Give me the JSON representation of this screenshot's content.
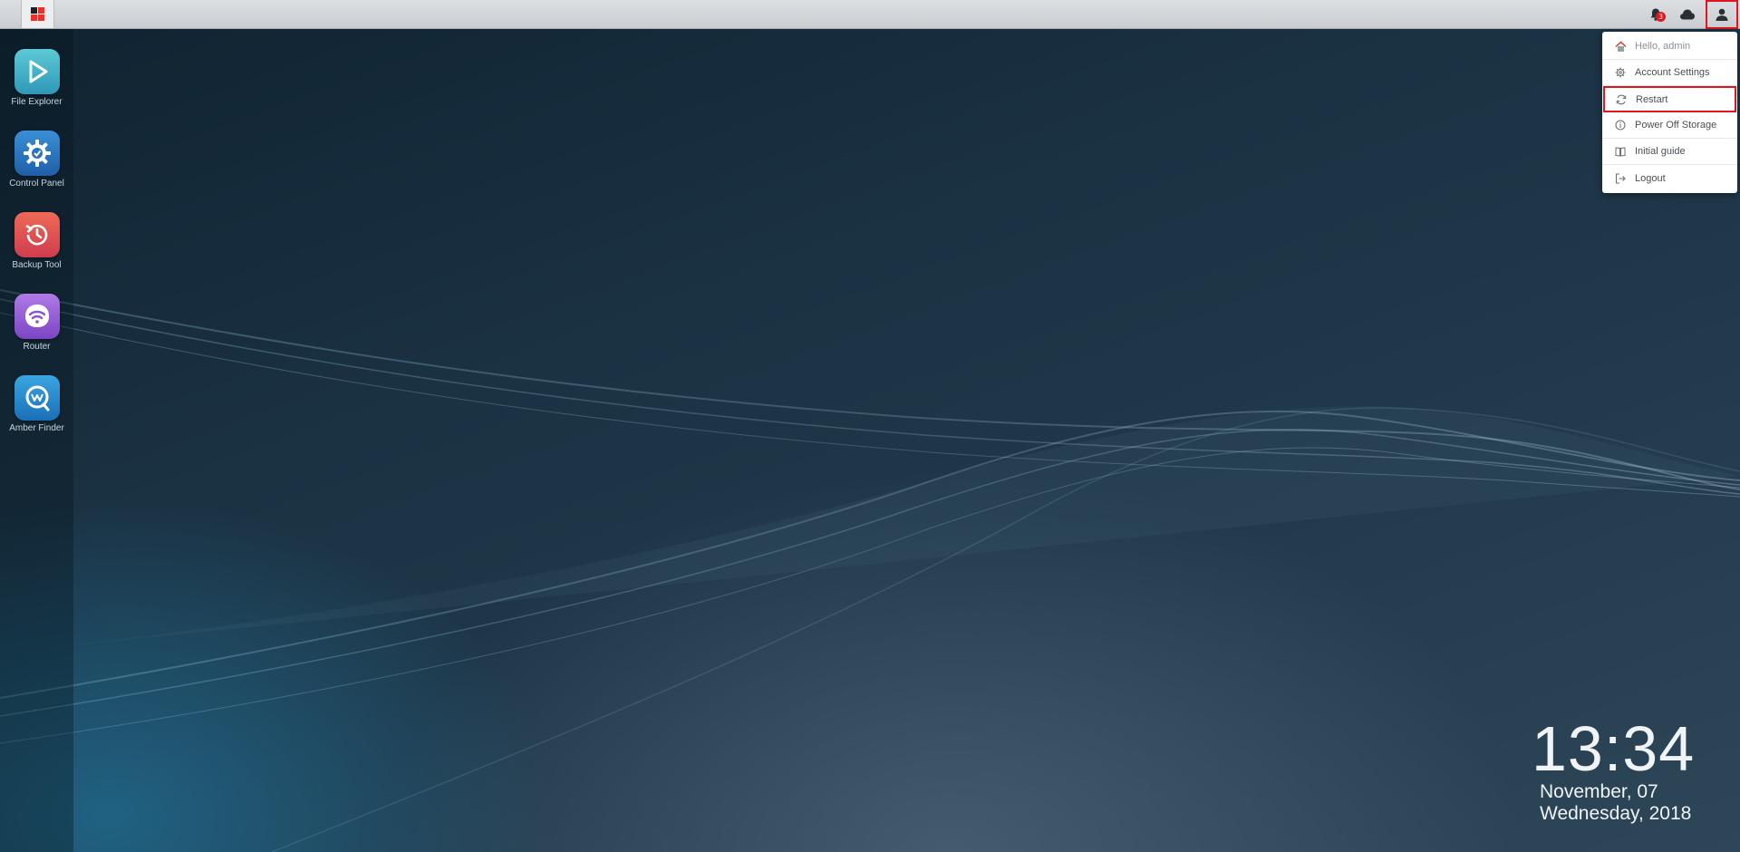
{
  "topbar": {
    "launcher_icon": "apps-grid-icon",
    "notifications": {
      "icon": "bell-icon",
      "count": "3"
    },
    "cloud_icon": "cloud-icon",
    "user_icon": "user-icon"
  },
  "desktop_apps": [
    {
      "label": "File Explorer",
      "icon": "file-explorer-icon",
      "color": "#3fb6c8"
    },
    {
      "label": "Control Panel",
      "icon": "gear-icon",
      "color": "#2a7bc4"
    },
    {
      "label": "Backup Tool",
      "icon": "backup-clock-icon",
      "color": "#e25a4e"
    },
    {
      "label": "Router",
      "icon": "wifi-router-icon",
      "color": "#9a5fd6"
    },
    {
      "label": "Amber Finder",
      "icon": "finder-icon",
      "color": "#2d8fd6"
    }
  ],
  "user_menu": {
    "items": [
      {
        "label": "Hello, admin",
        "icon": "home-icon"
      },
      {
        "label": "Account Settings",
        "icon": "gear-icon"
      },
      {
        "label": "Restart",
        "icon": "refresh-icon"
      },
      {
        "label": "Power Off Storage",
        "icon": "info-icon"
      },
      {
        "label": "Initial guide",
        "icon": "book-icon"
      },
      {
        "label": "Logout",
        "icon": "logout-icon"
      }
    ]
  },
  "clock": {
    "time": "13:34",
    "date": "November, 07",
    "weekday": "Wednesday, 2018"
  },
  "colors": {
    "accent_red": "#e0161e",
    "topbar_bg": "#d2d5d8"
  }
}
